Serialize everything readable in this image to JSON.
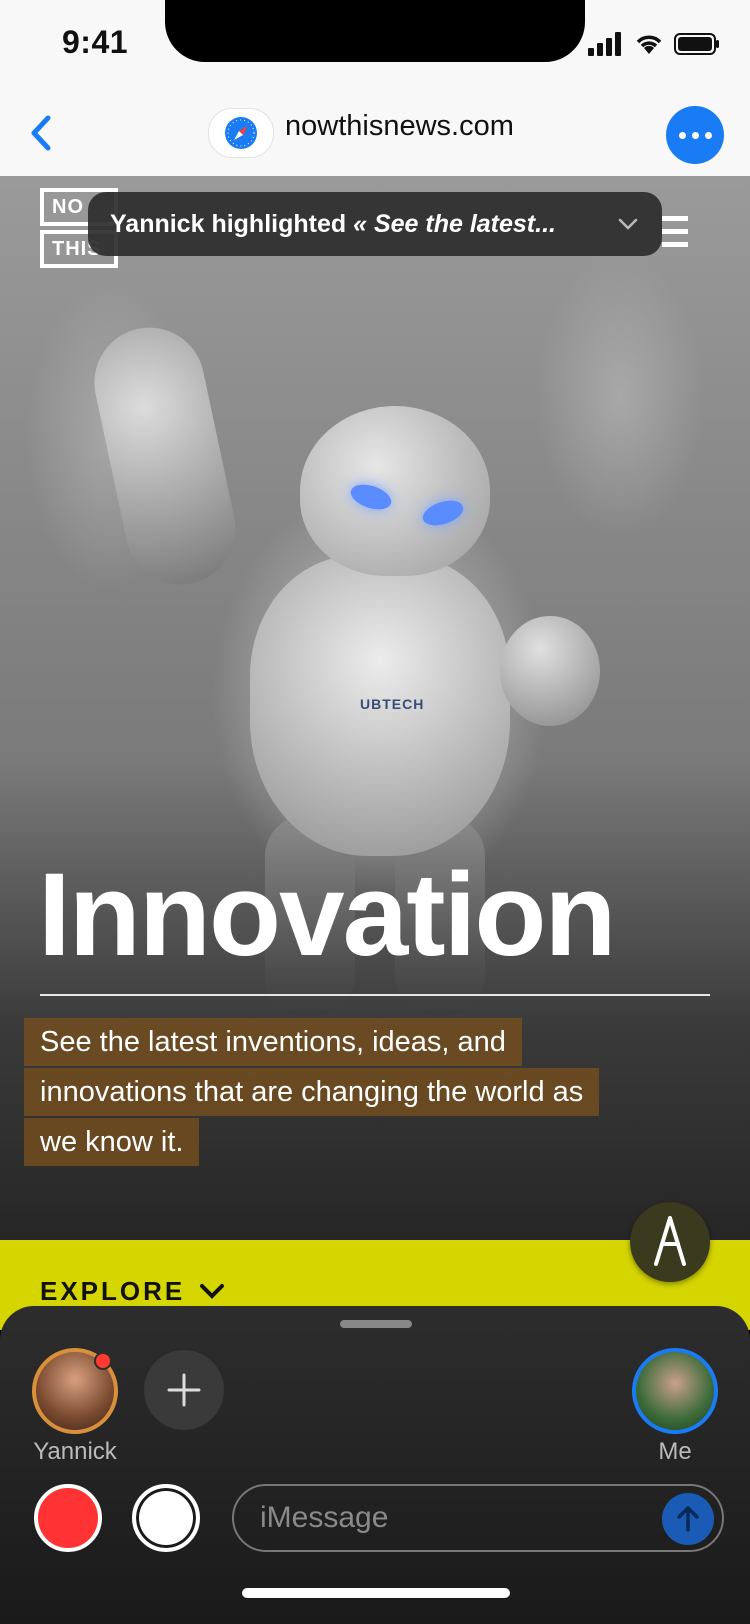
{
  "status_bar": {
    "time": "9:41"
  },
  "browser": {
    "url": "nowthisnews.com"
  },
  "logo": {
    "line1": "NO",
    "line2": "THIS"
  },
  "highlight": {
    "author_text": "Yannick highlighted ",
    "quote_text": "« See the latest..."
  },
  "hero": {
    "headline": "Innovation",
    "brand_mark": "UBTECH",
    "subtitle_lines": [
      "See the latest inventions, ideas, and",
      "innovations that are changing the world as",
      "we know it."
    ]
  },
  "explore": {
    "label": "EXPLORE"
  },
  "participants": [
    {
      "name": "Yannick",
      "has_notification": true
    },
    {
      "name": "Me"
    }
  ],
  "composer": {
    "placeholder": "iMessage"
  },
  "icons": [
    "back-chevron-icon",
    "safari-compass-icon",
    "more-dots-icon",
    "chevron-down-icon",
    "hamburger-menu-icon",
    "markup-pen-icon",
    "plus-icon",
    "send-arrow-icon",
    "signal-icon",
    "wifi-icon",
    "battery-icon"
  ],
  "colors": {
    "accent_blue": "#1a7cf5",
    "explore_yellow": "#d5d500",
    "highlight_brown": "#784f1e",
    "record_red": "#ff3333"
  }
}
